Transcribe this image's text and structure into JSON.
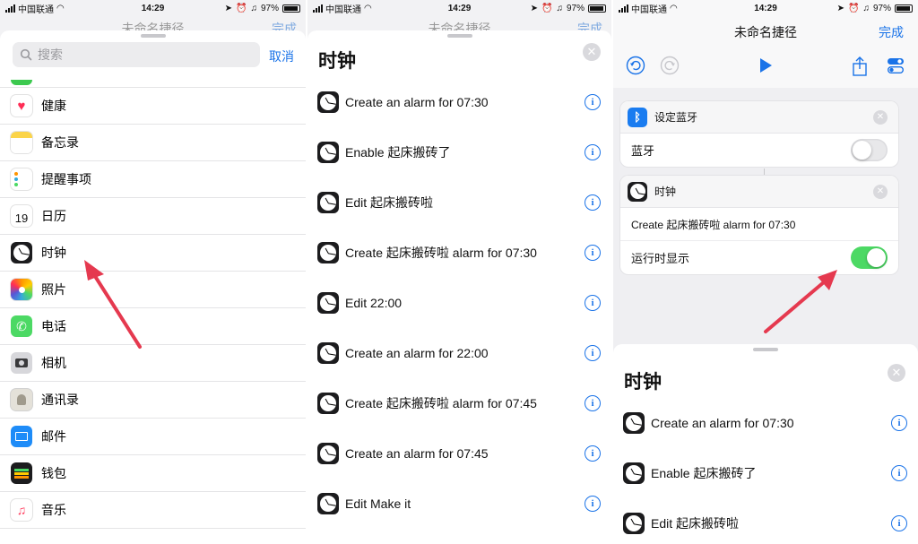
{
  "status": {
    "carrier": "中国联通",
    "time": "14:29",
    "battery": "97%"
  },
  "panel1": {
    "bg_title": "未命名捷径",
    "bg_done": "完成",
    "search": {
      "placeholder": "搜索"
    },
    "cancel_label": "取消",
    "apps": [
      {
        "label": "健康",
        "icon": "health-icon"
      },
      {
        "label": "备忘录",
        "icon": "notes-icon"
      },
      {
        "label": "提醒事项",
        "icon": "reminders-icon"
      },
      {
        "label": "日历",
        "icon": "calendar-icon",
        "day": "19"
      },
      {
        "label": "时钟",
        "icon": "clock-icon"
      },
      {
        "label": "照片",
        "icon": "photos-icon"
      },
      {
        "label": "电话",
        "icon": "phone-icon"
      },
      {
        "label": "相机",
        "icon": "camera-icon"
      },
      {
        "label": "通讯录",
        "icon": "contacts-icon"
      },
      {
        "label": "邮件",
        "icon": "mail-icon"
      },
      {
        "label": "钱包",
        "icon": "wallet-icon"
      },
      {
        "label": "音乐",
        "icon": "music-icon"
      }
    ]
  },
  "panel2": {
    "bg_title": "未命名捷径",
    "bg_done": "完成",
    "title": "时钟",
    "actions": [
      "Create an alarm for 07:30",
      "Enable 起床搬砖了",
      "Edit 起床搬砖啦",
      "Create 起床搬砖啦 alarm for 07:30",
      "Edit 22:00",
      "Create an alarm for 22:00",
      "Create 起床搬砖啦 alarm for 07:45",
      "Create an alarm for 07:45",
      "Edit Make it"
    ]
  },
  "panel3": {
    "title": "未命名捷径",
    "done_label": "完成",
    "bluetooth_card": {
      "title": "设定蓝牙",
      "row_label": "蓝牙",
      "toggle_on": false
    },
    "clock_card": {
      "title": "时钟",
      "summary": "Create 起床搬砖啦 alarm for 07:30",
      "row_label": "运行时显示",
      "toggle_on": true
    },
    "sheet_title": "时钟",
    "sheet_actions": [
      "Create an alarm for 07:30",
      "Enable 起床搬砖了",
      "Edit 起床搬砖啦"
    ]
  },
  "colors": {
    "accent": "#1a73e8",
    "toggle_on": "#4cd964",
    "arrow": "#e5394f"
  }
}
